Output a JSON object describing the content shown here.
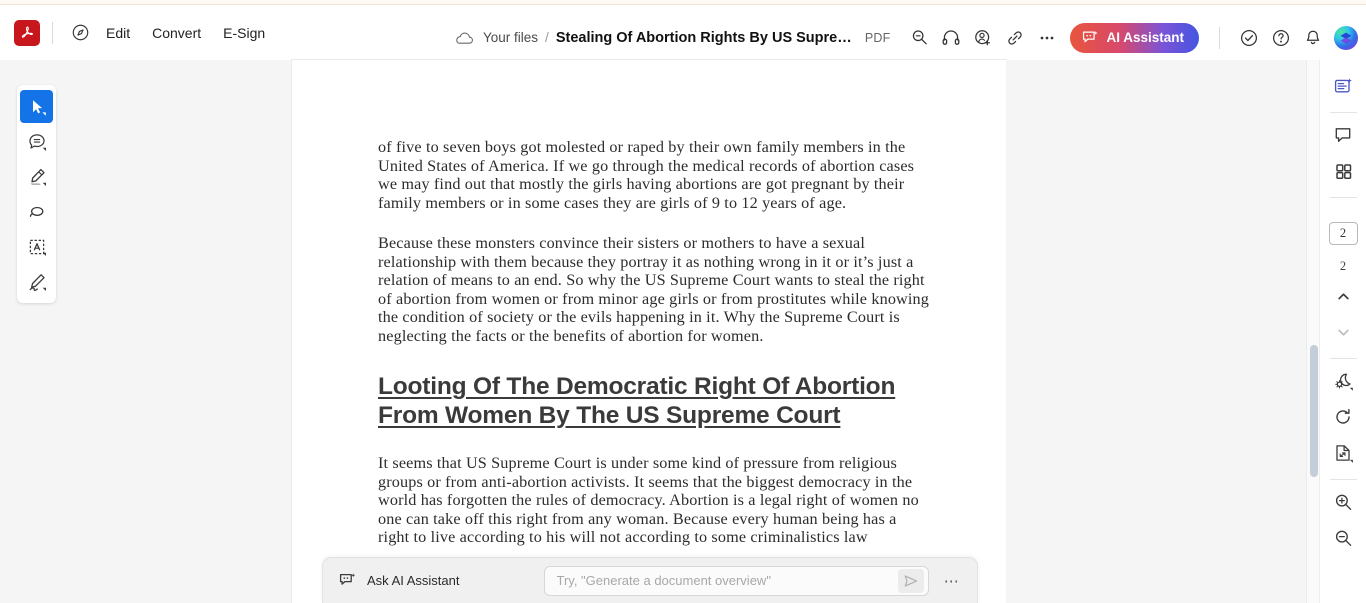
{
  "app": {
    "logo": "acrobat-logo",
    "accent_blue": "#1473e6",
    "brand_red": "#c8161d"
  },
  "topbar": {
    "home_icon": "home-compass-icon",
    "menus": [
      {
        "label": "Edit",
        "name": "menu-edit"
      },
      {
        "label": "Convert",
        "name": "menu-convert"
      },
      {
        "label": "E-Sign",
        "name": "menu-esign"
      }
    ],
    "breadcrumb": {
      "cloud_icon": "cloud-icon",
      "root": "Your files",
      "separator": "/",
      "title": "Stealing Of Abortion Rights By US Supreme Cour…",
      "filetype": "PDF"
    },
    "right_icons": [
      {
        "name": "search-icon"
      },
      {
        "name": "headphones-icon"
      },
      {
        "name": "share-person-icon"
      },
      {
        "name": "link-icon"
      },
      {
        "name": "more-ellipsis-icon"
      }
    ],
    "ai_button": {
      "label": "AI Assistant",
      "icon": "ai-sparkle-chat-icon",
      "gradient_from": "#e8553d",
      "gradient_to": "#4455e0"
    },
    "trailing_icons": [
      {
        "name": "check-circle-icon"
      },
      {
        "name": "help-circle-icon"
      },
      {
        "name": "bell-icon"
      }
    ],
    "avatar": {
      "name": "user-avatar"
    }
  },
  "left_tools": [
    {
      "name": "tool-select-cursor",
      "icon": "cursor-arrow-icon",
      "active": true,
      "has_caret": true
    },
    {
      "name": "tool-add-comment",
      "icon": "comment-bubble-icon",
      "active": false,
      "has_caret": true
    },
    {
      "name": "tool-highlight",
      "icon": "highlighter-pen-icon",
      "active": false,
      "has_caret": true
    },
    {
      "name": "tool-draw-lasso",
      "icon": "lasso-loop-icon",
      "active": false,
      "has_caret": false
    },
    {
      "name": "tool-edit-text",
      "icon": "text-box-a-icon",
      "active": false,
      "has_caret": true
    },
    {
      "name": "tool-fill-and-sign",
      "icon": "signature-pen-icon",
      "active": false,
      "has_caret": true
    }
  ],
  "document": {
    "paragraphs": [
      "of five to seven boys got molested or raped by their own family members in the United States of America. If we go through the medical records of abortion cases we may find out that mostly the girls having abortions are got pregnant by their family members or in some cases they are girls of 9 to 12 years of age.",
      "Because these monsters convince their sisters or mothers to have a sexual relationship with them because they portray it as nothing wrong in it or it’s just a relation of means to an end. So why the US Supreme Court wants to steal the right of abortion from women or from minor age girls or from prostitutes while knowing the condition of society or the evils happening in it. Why the Supreme Court is neglecting the facts or the benefits of abortion for women."
    ],
    "heading": "Looting Of The Democratic Right Of Abortion From Women By The US Supreme Court",
    "paragraph_after_heading": "It seems that US Supreme Court is under some kind of pressure from religious groups or from anti-abortion activists. It seems that the biggest democracy in the world has forgotten the rules of democracy. Abortion is a legal right of women no one can take off this right from any woman. Because every human being has a right to live according to his will not according to some criminalistics law"
  },
  "right_sidebar": {
    "items": [
      {
        "name": "ai-summary-panel-icon",
        "icon": "ai-document-sparkle-icon"
      },
      {
        "name": "comments-panel-icon",
        "icon": "comment-bubble-icon"
      },
      {
        "name": "page-thumbnails-icon",
        "icon": "grid-four-squares-icon"
      }
    ],
    "current_page": "2",
    "total_pages": "2",
    "prev_page_icon": "chevron-up-icon",
    "next_page_icon": "chevron-down-icon",
    "bottom_items": [
      {
        "name": "display-mode-icon",
        "icon": "sun-moon-icon"
      },
      {
        "name": "rotate-page-icon",
        "icon": "rotate-clockwise-icon"
      },
      {
        "name": "fit-page-icon",
        "icon": "page-fit-icon"
      },
      {
        "name": "zoom-in-icon",
        "icon": "magnifier-plus-icon"
      },
      {
        "name": "zoom-out-icon",
        "icon": "magnifier-minus-icon"
      }
    ]
  },
  "ai_bar": {
    "icon": "ai-sparkle-chat-icon",
    "label": "Ask AI Assistant",
    "input_value": "",
    "placeholder": "Try, \"Generate a document overview\"",
    "send_icon": "send-paper-plane-icon",
    "more_label": "⋯"
  }
}
